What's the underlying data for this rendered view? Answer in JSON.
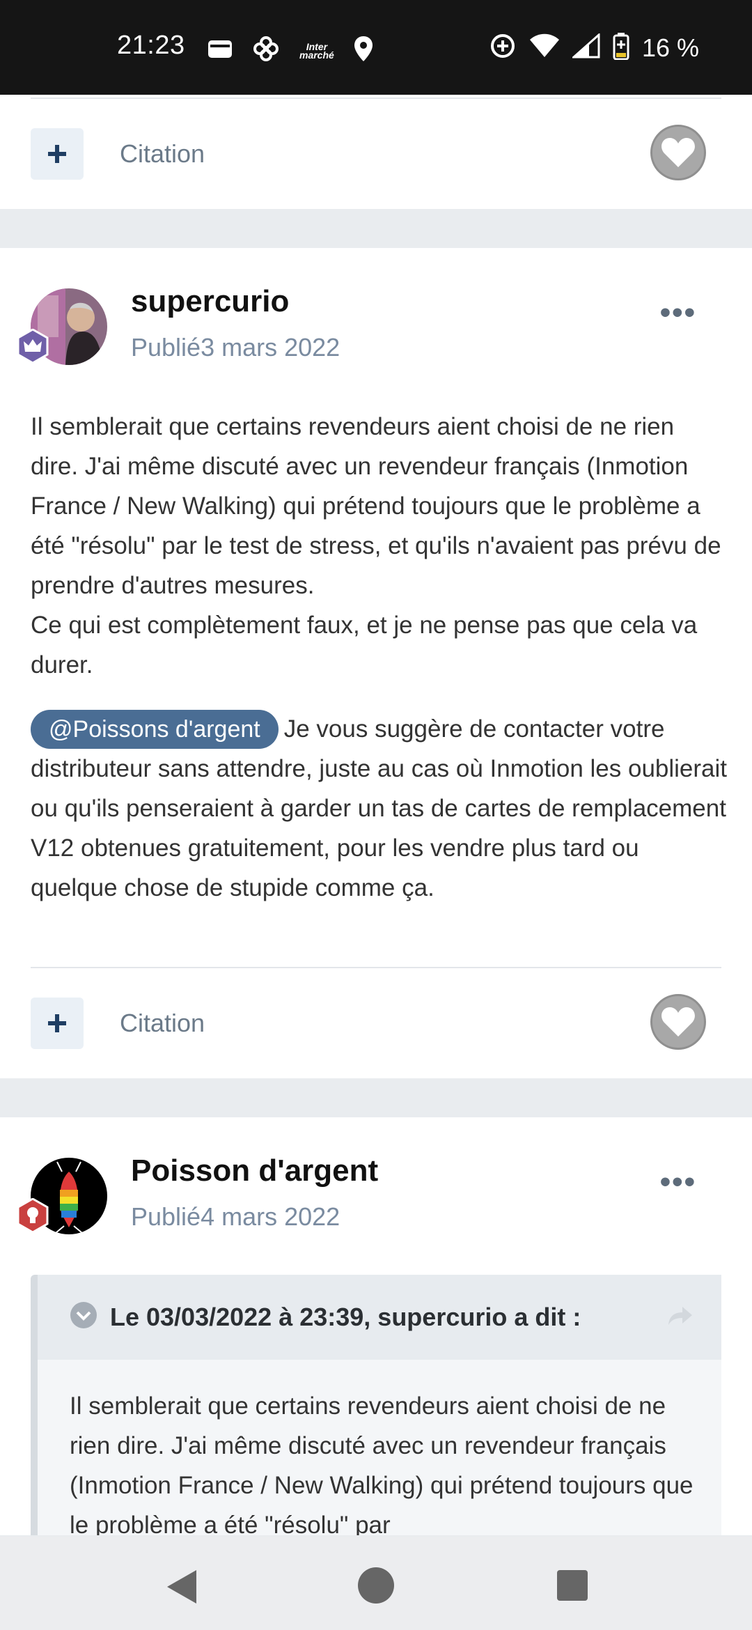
{
  "status_bar": {
    "time": "21:23",
    "battery_percent": "16 %",
    "intermarche_label": "Inter\nmarché",
    "icons": [
      "wallet-icon",
      "pinwheel-icon",
      "intermarche-icon",
      "location-icon",
      "data-saver-icon",
      "wifi-icon",
      "signal-icon",
      "battery-icon"
    ]
  },
  "posts": [
    {
      "footer": {
        "citation_label": "Citation"
      }
    },
    {
      "author": "supercurio",
      "published": "Publié3 mars 2022",
      "more": "•••",
      "paragraph1": "Il semblerait que certains revendeurs aient choisi de ne rien dire. J'ai même discuté avec un revendeur français (Inmotion France / New Walking) qui prétend toujours que le problème a été \"résolu\" par le test de stress, et qu'ils n'avaient pas prévu de prendre d'autres mesures.",
      "paragraph2": "Ce qui est complètement faux, et je ne pense pas que cela va durer.",
      "mention": "@Poissons d'argent",
      "paragraph3": "Je vous suggère de contacter votre distributeur sans attendre, juste au cas où Inmotion les oublierait ou qu'ils penseraient à garder un tas de cartes de remplacement V12 obtenues gratuitement, pour les vendre plus tard ou quelque chose de stupide comme ça.",
      "footer": {
        "citation_label": "Citation"
      }
    },
    {
      "author": "Poisson d'argent",
      "published": "Publié4 mars 2022",
      "more": "•••",
      "quote": {
        "header": "Le 03/03/2022 à 23:39, supercurio a dit :",
        "text": "Il semblerait que certains revendeurs aient choisi de ne rien dire. J'ai même discuté avec un revendeur français (Inmotion France / New Walking) qui prétend toujours que le problème a été \"résolu\" par"
      }
    }
  ],
  "colors": {
    "mention_bg": "#4a6d94",
    "page_bg": "#e9ecef",
    "plus_btn_bg": "#eaf0f6",
    "heart_bg": "#a8a8a8"
  }
}
